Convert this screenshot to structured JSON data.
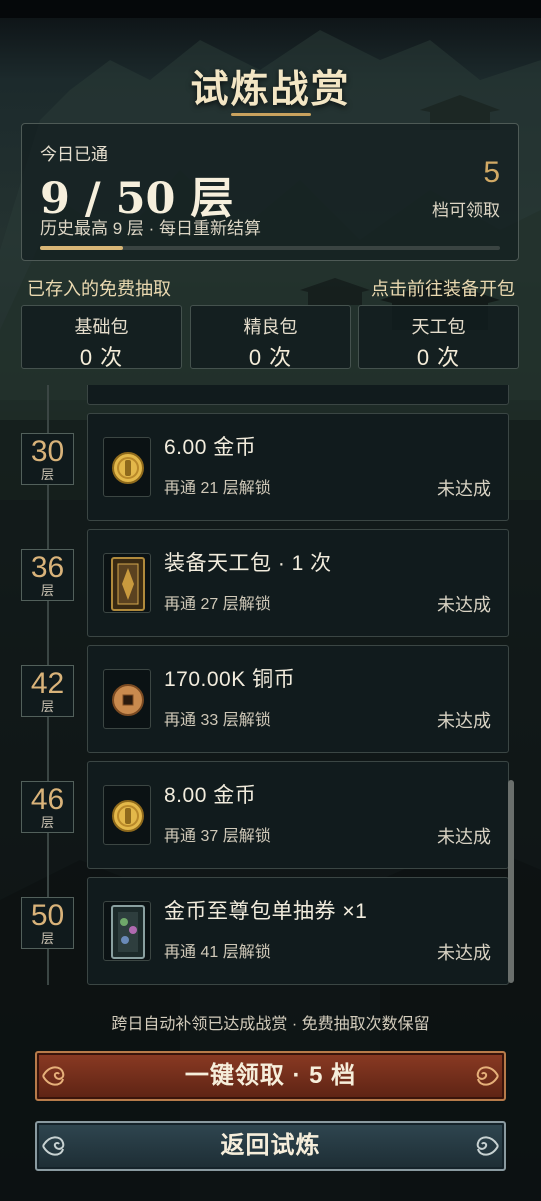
{
  "title": "试炼战赏",
  "progress": {
    "today_label": "今日已通",
    "floor_text": "9 / 50 层",
    "history_text": "历史最高 9 层 · 每日重新结算",
    "claimable_count": "5",
    "claimable_label": "档可领取",
    "fill_fraction": 0.18
  },
  "stored": {
    "label": "已存入的免费抽取",
    "link": "点击前往装备开包",
    "packs": [
      {
        "name": "基础包",
        "count": "0 次"
      },
      {
        "name": "精良包",
        "count": "0 次"
      },
      {
        "name": "天工包",
        "count": "0 次"
      }
    ]
  },
  "rewards": [
    {
      "floor": "30",
      "unit": "层",
      "title": "6.00 金币",
      "sub": "再通 21 层解锁",
      "status": "未达成",
      "icon": "gold-coin-icon"
    },
    {
      "floor": "36",
      "unit": "层",
      "title": "装备天工包 · 1 次",
      "sub": "再通 27 层解锁",
      "status": "未达成",
      "icon": "equipment-pack-icon"
    },
    {
      "floor": "42",
      "unit": "层",
      "title": "170.00K 铜币",
      "sub": "再通 33 层解锁",
      "status": "未达成",
      "icon": "copper-coin-icon"
    },
    {
      "floor": "46",
      "unit": "层",
      "title": "8.00 金币",
      "sub": "再通 37 层解锁",
      "status": "未达成",
      "icon": "gold-coin-icon"
    },
    {
      "floor": "50",
      "unit": "层",
      "title": "金币至尊包单抽券 ×1",
      "sub": "再通 41 层解锁",
      "status": "未达成",
      "icon": "supreme-ticket-icon"
    }
  ],
  "note": "跨日自动补领已达成战赏 · 免费抽取次数保留",
  "buttons": {
    "claim_all": "一键领取 · 5 档",
    "back": "返回试炼"
  },
  "colors": {
    "accent_gold": "#d2aa65",
    "claim_button": "#7a3220",
    "back_button": "#2a3f48"
  }
}
